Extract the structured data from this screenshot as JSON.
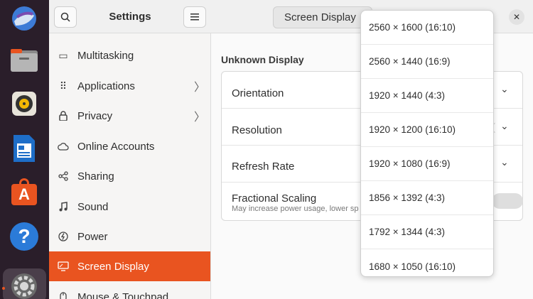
{
  "dock": {
    "items": [
      {
        "name": "Thunderbird",
        "icon": "thunderbird-icon"
      },
      {
        "name": "Files",
        "icon": "files-icon"
      },
      {
        "name": "Rhythmbox",
        "icon": "rhythmbox-icon"
      },
      {
        "name": "LibreOffice Writer",
        "icon": "writer-icon"
      },
      {
        "name": "Ubuntu Software",
        "icon": "software-icon"
      },
      {
        "name": "Help",
        "icon": "help-icon"
      },
      {
        "name": "Settings",
        "icon": "settings-icon"
      }
    ],
    "help_glyph": "?",
    "software_glyph": "A"
  },
  "sidebar": {
    "title": "Settings",
    "items": [
      {
        "label": "Multitasking",
        "icon": "multitasking-icon",
        "glyph": "▭",
        "chevron": false
      },
      {
        "label": "Applications",
        "icon": "applications-icon",
        "glyph": "⠿",
        "chevron": true
      },
      {
        "label": "Privacy",
        "icon": "lock-icon",
        "glyph": "🔒︎",
        "chevron": true
      },
      {
        "label": "Online Accounts",
        "icon": "cloud-icon",
        "glyph": "☁",
        "chevron": false
      },
      {
        "label": "Sharing",
        "icon": "share-icon",
        "glyph": "⋖",
        "chevron": false
      },
      {
        "label": "Sound",
        "icon": "music-note-icon",
        "glyph": "♫",
        "chevron": false
      },
      {
        "label": "Power",
        "icon": "power-icon",
        "glyph": "ϟ",
        "chevron": false
      },
      {
        "label": "Screen Display",
        "icon": "display-icon",
        "glyph": "▭",
        "chevron": false,
        "active": true
      },
      {
        "label": "Mouse & Touchpad",
        "icon": "mouse-icon",
        "glyph": "▯",
        "chevron": false
      }
    ],
    "chevron_glyph": "〉"
  },
  "main": {
    "tab_label": "Screen Display",
    "section_title": "Unknown Display",
    "rows": {
      "orientation": "Orientation",
      "resolution": "Resolution",
      "refresh_rate": "Refresh Rate",
      "fractional_scaling": "Fractional Scaling",
      "fractional_scaling_sub": "May increase power usage, lower sp"
    },
    "close_glyph": "✕",
    "chevron_down_glyph": "⌄"
  },
  "resolution_dropdown": {
    "options": [
      "2560 × 1600 (16:10)",
      "2560 × 1440 (16:9)",
      "1920 × 1440 (4:3)",
      "1920 × 1200 (16:10)",
      "1920 × 1080 (16:9)",
      "1856 × 1392 (4:3)",
      "1792 × 1344 (4:3)",
      "1680 × 1050 (16:10)"
    ]
  },
  "colors": {
    "accent": "#e95420",
    "dock_bg": "#2a1e2a"
  }
}
